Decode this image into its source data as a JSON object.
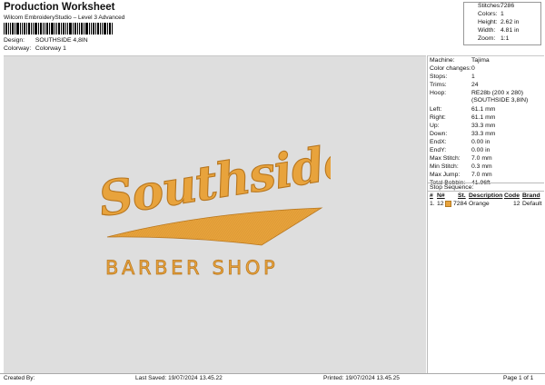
{
  "header": {
    "title": "Production Worksheet",
    "subtitle": "Wilcom EmbroideryStudio – Level 3 Advanced",
    "design_label": "Design:",
    "design_value": "SOUTHSIDE 4,8IN",
    "colorway_label": "Colorway:",
    "colorway_value": "Colorway 1"
  },
  "stats": [
    {
      "label": "Stitches:",
      "value": "7286"
    },
    {
      "label": "Colors:",
      "value": "1"
    },
    {
      "label": "Height:",
      "value": "2.62 in"
    },
    {
      "label": "Width:",
      "value": "4.81 in"
    },
    {
      "label": "Zoom:",
      "value": "1:1"
    }
  ],
  "design": {
    "script_text": "Southside",
    "block_text": "BARBER SHOP",
    "thread_color": "#e8a33c",
    "shadow_color": "#b7761f"
  },
  "properties": [
    {
      "label": "Machine:",
      "value": "Tajima"
    },
    {
      "label": "Color changes:",
      "value": "0"
    },
    {
      "label": "Stops:",
      "value": "1"
    },
    {
      "label": "Trims:",
      "value": "24"
    },
    {
      "label": "Hoop:",
      "value": "RE28b (200 x 280)",
      "value2": "(SOUTHSIDE 3,8IN)"
    },
    {
      "label": "Left:",
      "value": "61.1 mm"
    },
    {
      "label": "Right:",
      "value": "61.1 mm"
    },
    {
      "label": "Up:",
      "value": "33.3 mm"
    },
    {
      "label": "Down:",
      "value": "33.3 mm"
    },
    {
      "label": "EndX:",
      "value": "0.00 in"
    },
    {
      "label": "EndY:",
      "value": "0.00 in"
    },
    {
      "label": "Max Stitch:",
      "value": "7.0 mm"
    },
    {
      "label": "Min Stitch:",
      "value": "0.3 mm"
    },
    {
      "label": "Max Jump:",
      "value": "7.0 mm"
    },
    {
      "label": "Total Bobbin:",
      "value": "41.96ft"
    }
  ],
  "stop_sequence": {
    "title": "Stop Sequence:",
    "columns": [
      "#",
      "N#",
      "St.",
      "Description",
      "Code",
      "Brand"
    ],
    "rows": [
      {
        "num": "1.",
        "needle": "12",
        "stitches": "7284",
        "description": "Orange",
        "code": "12",
        "brand": "Default",
        "color": "#e8a33c"
      }
    ]
  },
  "footer": {
    "created_by": "Created By:",
    "last_saved": "Last Saved: 19/07/2024 13.45.22",
    "printed": "Printed: 19/07/2024 13.45.25",
    "page": "Page 1 of 1"
  }
}
